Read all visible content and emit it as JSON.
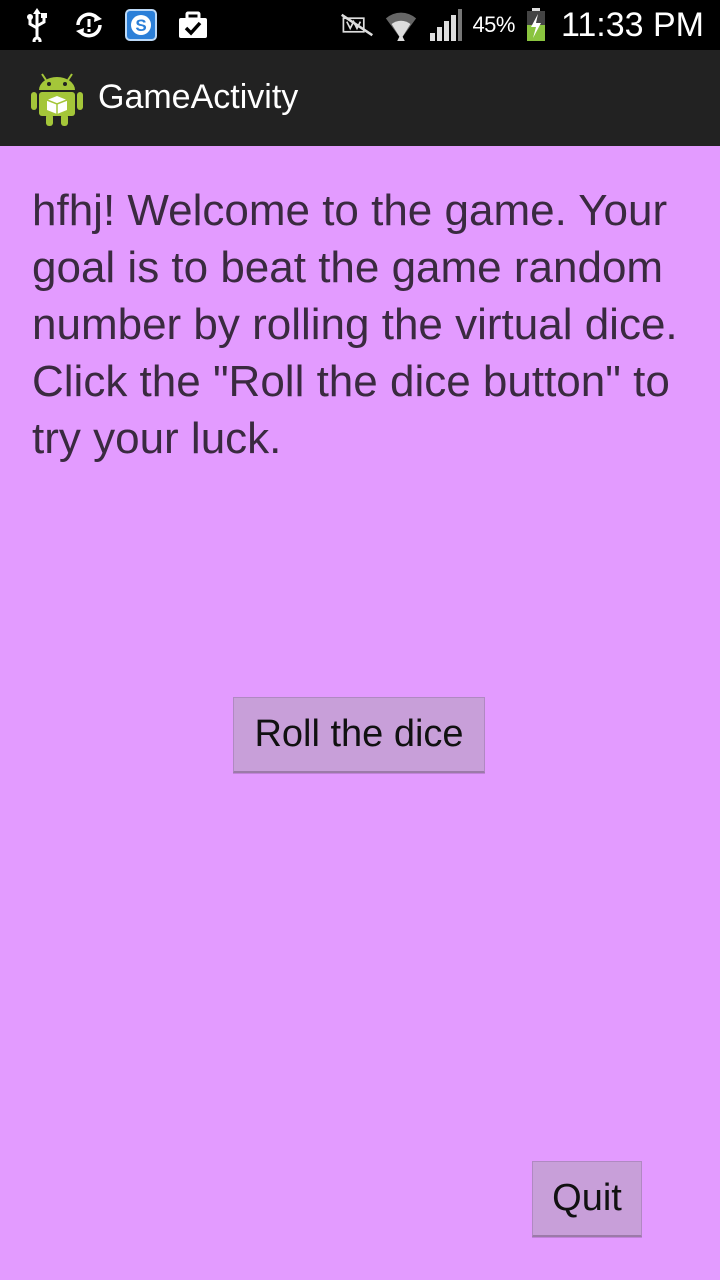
{
  "status_bar": {
    "battery_percent": "45%",
    "time": "11:33 PM",
    "icons": [
      "usb-icon",
      "sync-icon",
      "s-app-icon",
      "briefcase-check-icon",
      "mute-icon",
      "wifi-icon",
      "signal-icon",
      "battery-charging-icon"
    ]
  },
  "action_bar": {
    "title": "GameActivity"
  },
  "main": {
    "welcome_text": "hfhj! Welcome to the game. Your goal is to beat the game random number by rolling the virtual dice. Click the \"Roll the dice button\" to try your luck.",
    "roll_button_label": "Roll the dice",
    "quit_button_label": "Quit"
  },
  "colors": {
    "background": "#e39bff",
    "button": "#c89fd9",
    "action_bar": "#222222",
    "status_bar": "#000000"
  }
}
